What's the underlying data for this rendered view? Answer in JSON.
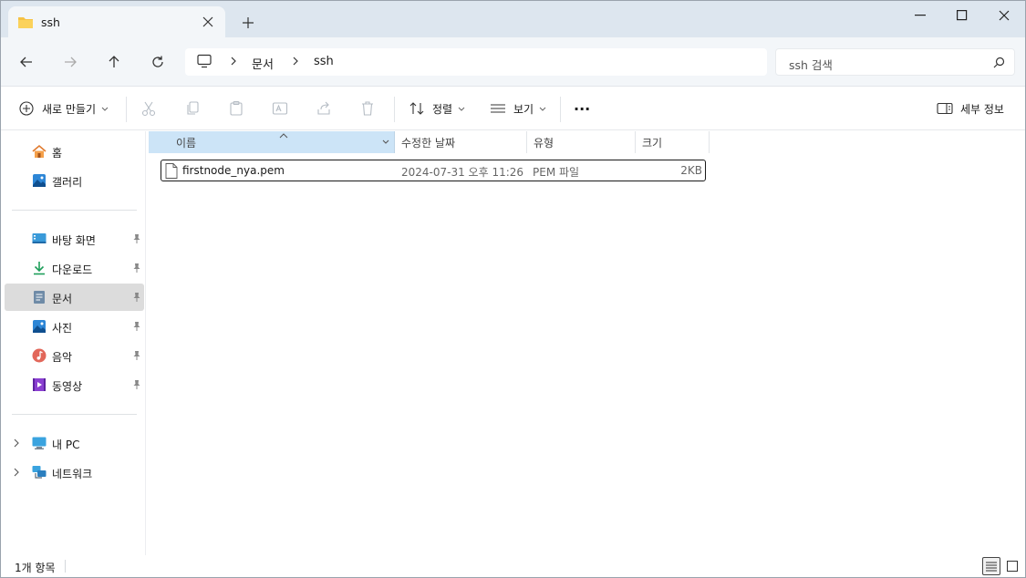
{
  "tab": {
    "title": "ssh"
  },
  "address": {
    "crumbs": [
      "문서",
      "ssh"
    ]
  },
  "search": {
    "placeholder": "ssh 검색"
  },
  "toolbar": {
    "new_label": "새로 만들기",
    "sort_label": "정렬",
    "view_label": "보기",
    "more_label": "···",
    "details_label": "세부 정보"
  },
  "sidebar": {
    "quick": [
      {
        "label": "홈",
        "icon": "home-icon"
      },
      {
        "label": "갤러리",
        "icon": "gallery-icon"
      }
    ],
    "pinned": [
      {
        "label": "바탕 화면",
        "icon": "desktop-icon"
      },
      {
        "label": "다운로드",
        "icon": "download-icon"
      },
      {
        "label": "문서",
        "icon": "documents-icon"
      },
      {
        "label": "사진",
        "icon": "pictures-icon"
      },
      {
        "label": "음악",
        "icon": "music-icon"
      },
      {
        "label": "동영상",
        "icon": "videos-icon"
      }
    ],
    "devices": [
      {
        "label": "내 PC",
        "icon": "pc-icon"
      },
      {
        "label": "네트워크",
        "icon": "network-icon"
      }
    ]
  },
  "columns": [
    "이름",
    "수정한 날짜",
    "유형",
    "크기"
  ],
  "files": [
    {
      "name": "firstnode_nya.pem",
      "date": "2024-07-31 오후 11:26",
      "type": "PEM 파일",
      "size": "2KB"
    }
  ],
  "status": {
    "count": "1개 항목"
  },
  "colors": {
    "selected_header": "#cce4f7",
    "titlebar": "#dde6ef",
    "accent": "#0067c0"
  }
}
